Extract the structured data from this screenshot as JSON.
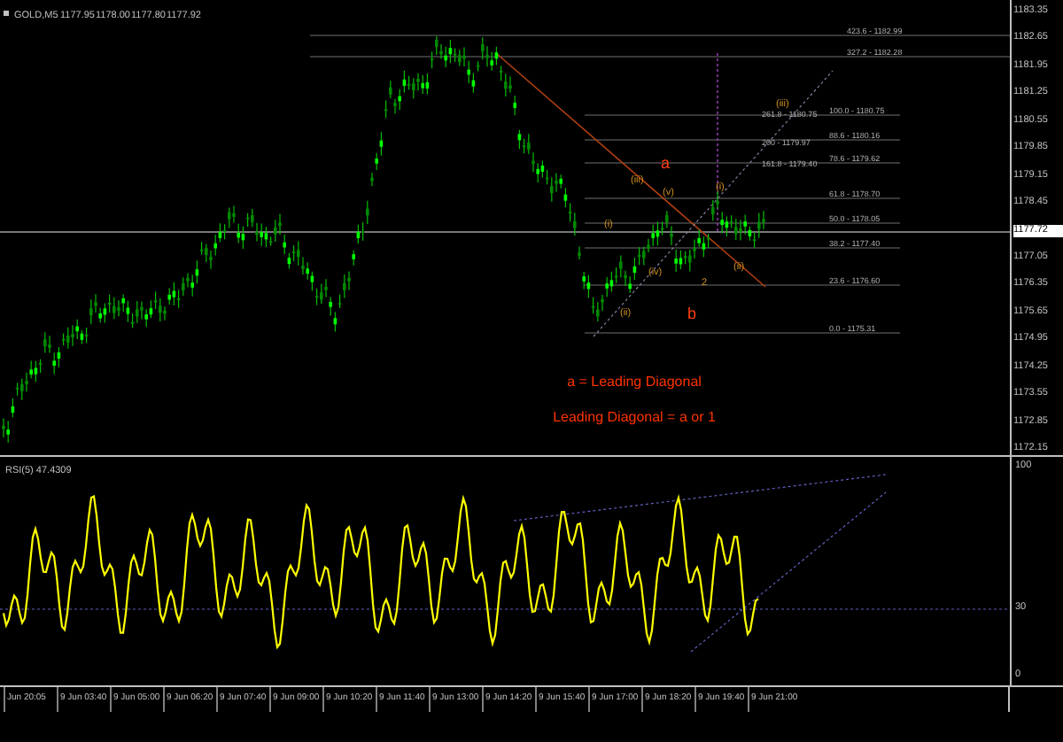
{
  "chart": {
    "symbol": "GOLD,M5",
    "quotes": [
      "1177.95",
      "1178.00",
      "1177.80",
      "1177.92"
    ]
  },
  "price_axis": [
    {
      "text": "1183.35",
      "kind": "tick"
    },
    {
      "text": "1182.65",
      "kind": "tick"
    },
    {
      "text": "1181.95",
      "kind": "tick"
    },
    {
      "text": "1181.25",
      "kind": "tick"
    },
    {
      "text": "1180.55",
      "kind": "tick"
    },
    {
      "text": "1179.85",
      "kind": "tick"
    },
    {
      "text": "1179.15",
      "kind": "tick"
    },
    {
      "text": "1178.45",
      "kind": "tick"
    },
    {
      "text": "1177.72",
      "kind": "current"
    },
    {
      "text": "1177.05",
      "kind": "tick"
    },
    {
      "text": "1176.35",
      "kind": "tick"
    },
    {
      "text": "1175.65",
      "kind": "tick"
    },
    {
      "text": "1174.95",
      "kind": "tick"
    },
    {
      "text": "1174.25",
      "kind": "tick"
    },
    {
      "text": "1173.55",
      "kind": "tick"
    },
    {
      "text": "1172.85",
      "kind": "tick"
    },
    {
      "text": "1172.15",
      "kind": "tick"
    }
  ],
  "fib_levels": [
    "423.6 - 1182.99",
    "327.2 - 1182.28",
    "261.8 - 1180.75",
    "200 - 1179.97",
    "161.8 - 1179.40",
    "100.0 - 1180.75",
    "88.6 - 1180.16",
    "78.6 - 1179.62",
    "61.8 - 1178.70",
    "50.0 - 1178.05",
    "38.2 - 1177.40",
    "23.6 - 1176.60",
    "0.0 - 1175.31"
  ],
  "wave_labels": [
    {
      "text": "a",
      "kind": "major"
    },
    {
      "text": "b",
      "kind": "major"
    },
    {
      "text": "2",
      "kind": "minor"
    },
    {
      "text": "(i)",
      "kind": "minor"
    },
    {
      "text": "(ii)",
      "kind": "minor"
    },
    {
      "text": "(iii)",
      "kind": "minor"
    },
    {
      "text": "(iv)",
      "kind": "minor"
    },
    {
      "text": "(v)",
      "kind": "minor"
    },
    {
      "text": "(i)",
      "kind": "minor"
    },
    {
      "text": "(ii)",
      "kind": "minor"
    },
    {
      "text": "(iii)",
      "kind": "minor"
    }
  ],
  "notes": [
    "a = Leading Diagonal",
    "Leading Diagonal = a or 1"
  ],
  "rsi": {
    "title": "RSI(5) 47.4309",
    "levels": [
      "100",
      "30",
      "0"
    ]
  },
  "time_axis": [
    "Jun 20:05",
    "9 Jun 03:40",
    "9 Jun 05:00",
    "9 Jun 06:20",
    "9 Jun 07:40",
    "9 Jun 09:00",
    "9 Jun 10:20",
    "9 Jun 11:40",
    "9 Jun 13:00",
    "9 Jun 14:20",
    "9 Jun 15:40",
    "9 Jun 17:00",
    "9 Jun 18:20",
    "9 Jun 19:40",
    "9 Jun 21:00"
  ]
}
